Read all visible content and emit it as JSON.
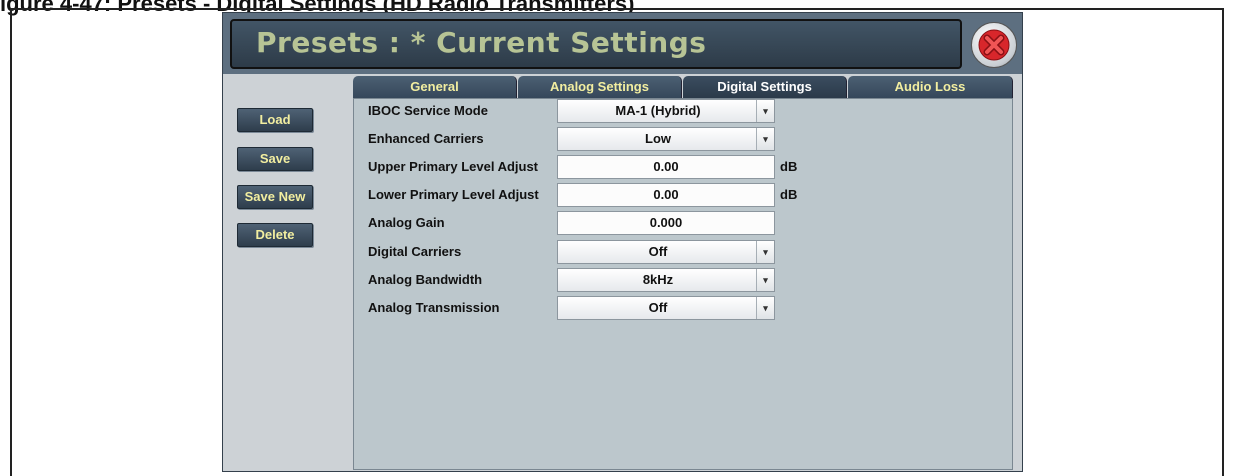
{
  "caption": "igure 4-47: Presets - Digital Settings (HD Radio Transmitters)",
  "window": {
    "title": "Presets : *  Current Settings",
    "close_icon": "close-x-icon"
  },
  "sidebar": {
    "buttons": [
      {
        "label": "Load"
      },
      {
        "label": "Save"
      },
      {
        "label": "Save New"
      },
      {
        "label": "Delete"
      }
    ]
  },
  "tabs": [
    {
      "label": "General",
      "active": false
    },
    {
      "label": "Analog Settings",
      "active": false
    },
    {
      "label": "Digital Settings",
      "active": true
    },
    {
      "label": "Audio Loss",
      "active": false
    }
  ],
  "settings": [
    {
      "label": "IBOC Service Mode",
      "value": "MA-1 (Hybrid)",
      "kind": "select",
      "unit": ""
    },
    {
      "label": "Enhanced Carriers",
      "value": "Low",
      "kind": "select",
      "unit": ""
    },
    {
      "label": "Upper Primary Level Adjust",
      "value": "0.00",
      "kind": "input",
      "unit": "dB"
    },
    {
      "label": "Lower Primary Level Adjust",
      "value": "0.00",
      "kind": "input",
      "unit": "dB"
    },
    {
      "label": "Analog Gain",
      "value": "0.000",
      "kind": "input",
      "unit": ""
    },
    {
      "label": "Digital Carriers",
      "value": "Off",
      "kind": "select",
      "unit": ""
    },
    {
      "label": "Analog Bandwidth",
      "value": "8kHz",
      "kind": "select",
      "unit": ""
    },
    {
      "label": "Analog Transmission",
      "value": "Off",
      "kind": "select",
      "unit": ""
    }
  ],
  "colors": {
    "title_text": "#b7c495",
    "button_text": "#f2eea0",
    "panel_bg": "#bcc7cc",
    "close_red": "#d8262b"
  }
}
